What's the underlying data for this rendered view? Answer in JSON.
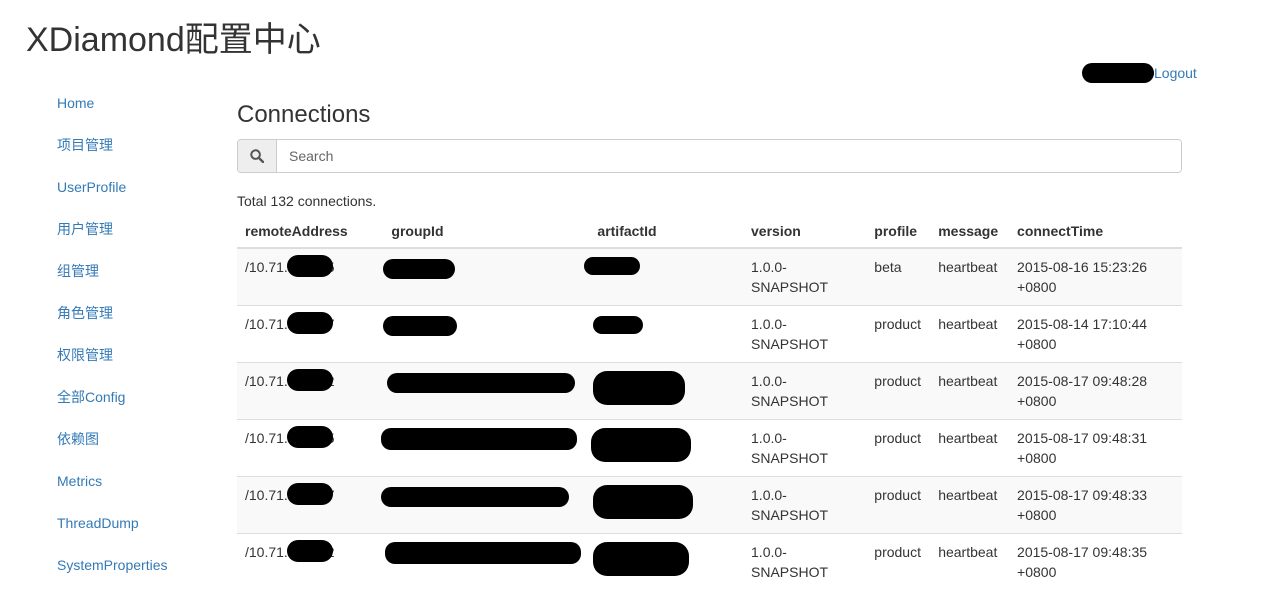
{
  "app": {
    "title": "XDiamond配置中心"
  },
  "user": {
    "logout_label": "Logout"
  },
  "sidebar": {
    "items": [
      {
        "label": "Home"
      },
      {
        "label": "项目管理"
      },
      {
        "label": "UserProfile"
      },
      {
        "label": "用户管理"
      },
      {
        "label": "组管理"
      },
      {
        "label": "角色管理"
      },
      {
        "label": "权限管理"
      },
      {
        "label": "全部Config"
      },
      {
        "label": "依赖图"
      },
      {
        "label": "Metrics"
      },
      {
        "label": "ThreadDump"
      },
      {
        "label": "SystemProperties"
      }
    ]
  },
  "main": {
    "title": "Connections",
    "search": {
      "placeholder": "Search",
      "icon": "search-icon"
    },
    "total_text": "Total 132 connections.",
    "table": {
      "headers": [
        "remoteAddress",
        "groupId",
        "artifactId",
        "version",
        "profile",
        "message",
        "connectTime"
      ],
      "rows": [
        {
          "remoteAddress": "/10.71.   :31875",
          "version": "1.0.0-SNAPSHOT",
          "profile": "beta",
          "message": "heartbeat",
          "connectTime": "2015-08-16 15:23:26 +0800"
        },
        {
          "remoteAddress": "/10.71.   :32867",
          "version": "1.0.0-SNAPSHOT",
          "profile": "product",
          "message": "heartbeat",
          "connectTime": "2015-08-14 17:10:44 +0800"
        },
        {
          "remoteAddress": "/10.71.   :32492",
          "version": "1.0.0-SNAPSHOT",
          "profile": "product",
          "message": "heartbeat",
          "connectTime": "2015-08-17 09:48:28 +0800"
        },
        {
          "remoteAddress": "/10.71.   :32505",
          "version": "1.0.0-SNAPSHOT",
          "profile": "product",
          "message": "heartbeat",
          "connectTime": "2015-08-17 09:48:31 +0800"
        },
        {
          "remoteAddress": "/10.71.   :32527",
          "version": "1.0.0-SNAPSHOT",
          "profile": "product",
          "message": "heartbeat",
          "connectTime": "2015-08-17 09:48:33 +0800"
        },
        {
          "remoteAddress": "/10.71.   :32532",
          "version": "1.0.0-SNAPSHOT",
          "profile": "product",
          "message": "heartbeat",
          "connectTime": "2015-08-17 09:48:35 +0800"
        }
      ]
    }
  },
  "colors": {
    "link": "#337ab7",
    "text": "#333333",
    "stripe": "#f9f9f9",
    "border": "#dddddd",
    "redaction": "#000000"
  }
}
